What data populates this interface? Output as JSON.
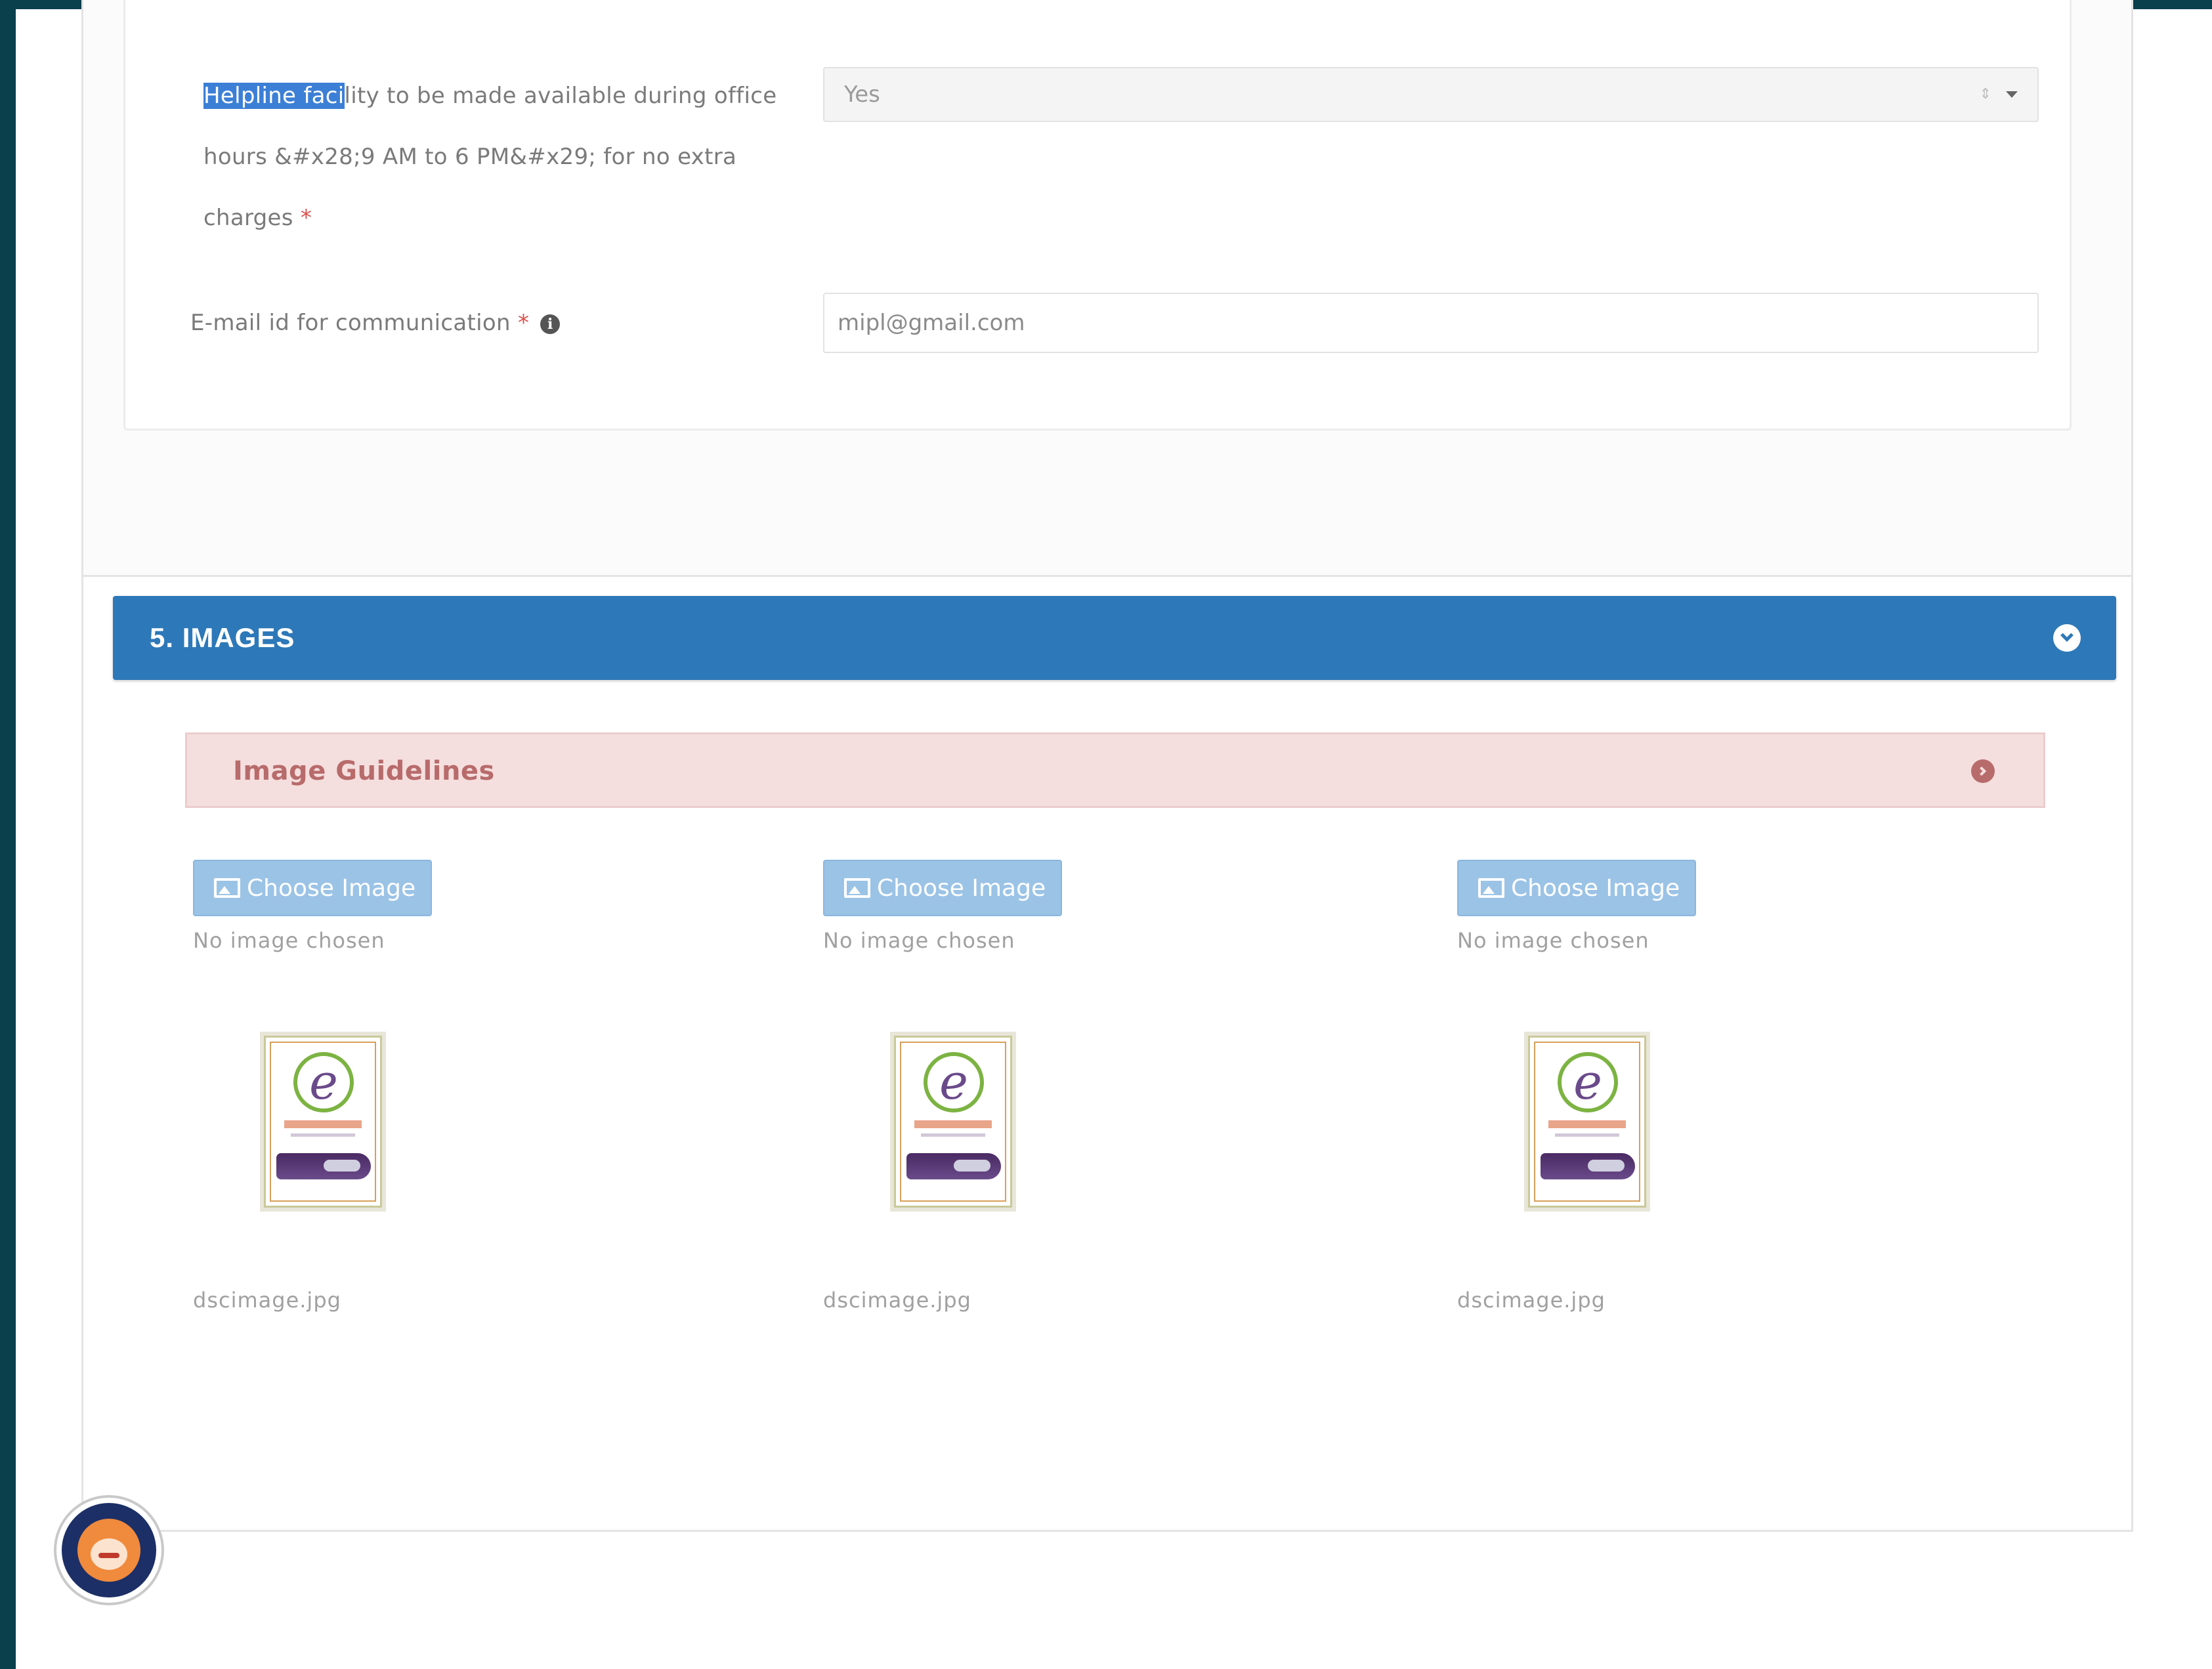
{
  "form": {
    "helpline": {
      "label_highlighted": "Helpline faci",
      "label_rest": "lity to be made available during office hours &#x28;9 AM to 6 PM&#x29; for no extra charges",
      "required_mark": "*",
      "value": "Yes"
    },
    "email": {
      "label": "E-mail id for communication",
      "required_mark": "*",
      "info_icon": "info-circle-icon",
      "value": "mipl@gmail.com"
    }
  },
  "section": {
    "title": "5. IMAGES",
    "toggle_icon": "chevron-down-circle-icon",
    "header_color": "#2d78b8"
  },
  "guidelines": {
    "title": "Image Guidelines",
    "toggle_icon": "chevron-right-circle-icon",
    "bg_color": "#f5dede"
  },
  "images": [
    {
      "button_label": "Choose Image",
      "status": "No image chosen",
      "file_name": "dscimage.jpg"
    },
    {
      "button_label": "Choose Image",
      "status": "No image chosen",
      "file_name": "dscimage.jpg"
    },
    {
      "button_label": "Choose Image",
      "status": "No image chosen",
      "file_name": "dscimage.jpg"
    }
  ],
  "chat_widget": {
    "icon": "chat-assistant-avatar-icon"
  }
}
